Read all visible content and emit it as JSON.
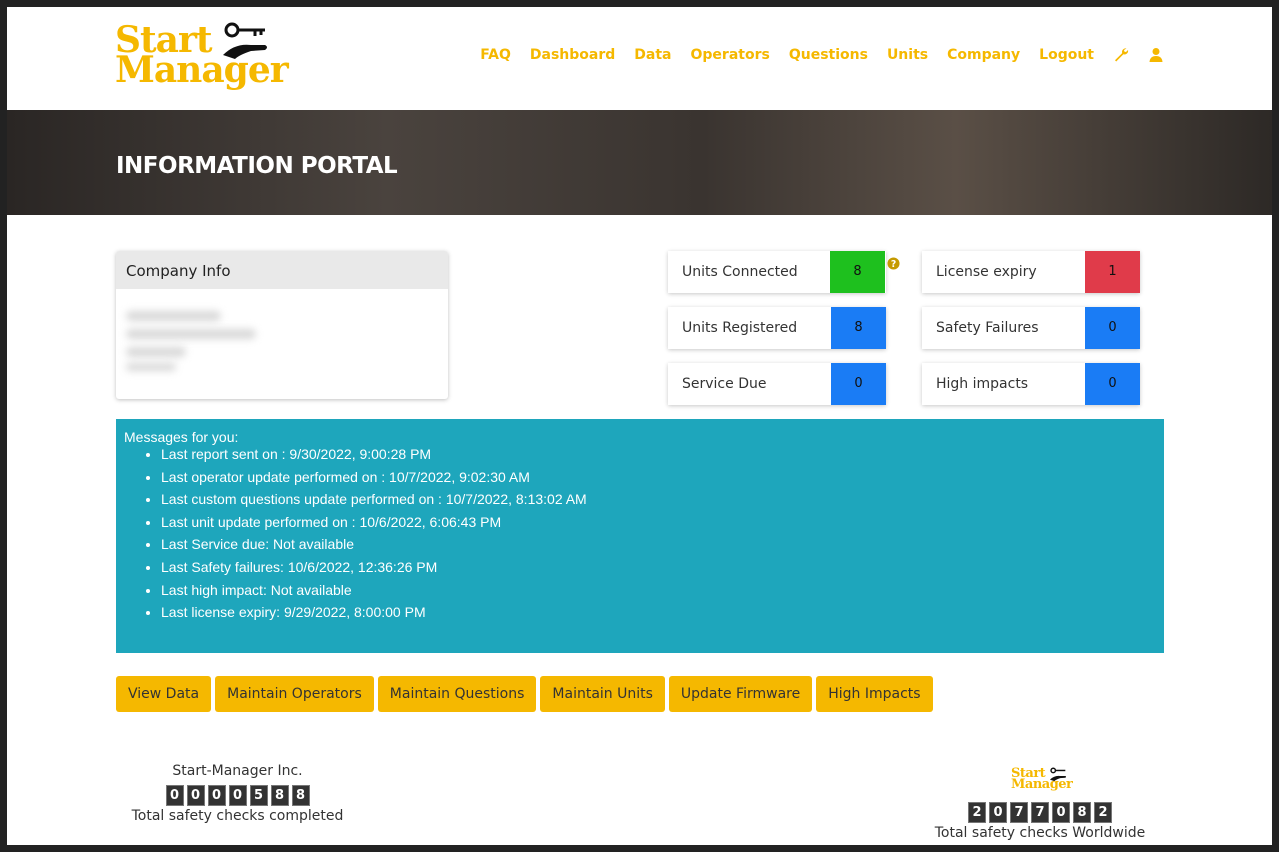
{
  "brand": {
    "line1": "Start",
    "line2": "Manager"
  },
  "nav": {
    "items": [
      "FAQ",
      "Dashboard",
      "Data",
      "Operators",
      "Questions",
      "Units",
      "Company",
      "Logout"
    ],
    "icons": [
      "wrench-icon",
      "user-icon"
    ]
  },
  "banner": {
    "title": "INFORMATION PORTAL"
  },
  "company": {
    "title": "Company Info"
  },
  "stats": [
    {
      "label": "Units Connected",
      "value": "8",
      "color": "#1ec01e"
    },
    {
      "label": "Units Registered",
      "value": "8",
      "color": "#1a7cf5"
    },
    {
      "label": "Service Due",
      "value": "0",
      "color": "#1a7cf5"
    },
    {
      "label": "License expiry",
      "value": "1",
      "color": "#e03b4a"
    },
    {
      "label": "Safety Failures",
      "value": "0",
      "color": "#1a7cf5"
    },
    {
      "label": "High impacts",
      "value": "0",
      "color": "#1a7cf5"
    }
  ],
  "messages": {
    "title": "Messages for you:",
    "items": [
      "Last report sent on : 9/30/2022, 9:00:28 PM",
      "Last operator update performed on : 10/7/2022, 9:02:30 AM",
      "Last custom questions update performed on : 10/7/2022, 8:13:02 AM",
      "Last unit update performed on : 10/6/2022, 6:06:43 PM",
      "Last Service due: Not available",
      "Last Safety failures: 10/6/2022, 12:36:26 PM",
      "Last high impact: Not available",
      "Last license expiry: 9/29/2022, 8:00:00 PM"
    ]
  },
  "buttons": [
    "View Data",
    "Maintain Operators",
    "Maintain Questions",
    "Maintain Units",
    "Update Firmware",
    "High Impacts"
  ],
  "footer": {
    "company_name": "Start-Manager Inc.",
    "company_count": "0000588",
    "company_caption": "Total safety checks completed",
    "worldwide_count": "2077082",
    "worldwide_caption": "Total safety checks Worldwide"
  }
}
